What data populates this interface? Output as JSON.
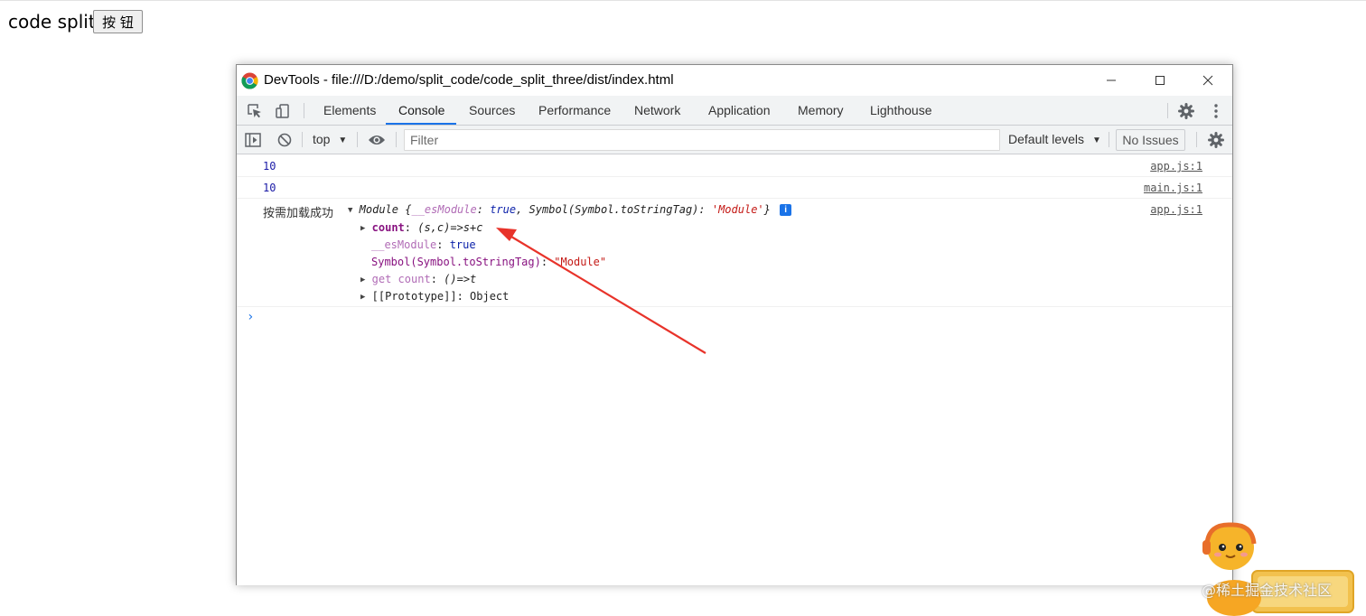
{
  "page": {
    "heading": "code split",
    "button_label": "按 钮"
  },
  "window": {
    "title": "DevTools - file:///D:/demo/split_code/code_split_three/dist/index.html"
  },
  "tabs": [
    {
      "label": "Elements",
      "active": false
    },
    {
      "label": "Console",
      "active": true
    },
    {
      "label": "Sources",
      "active": false
    },
    {
      "label": "Performance",
      "active": false
    },
    {
      "label": "Network",
      "active": false
    },
    {
      "label": "Application",
      "active": false
    },
    {
      "label": "Memory",
      "active": false
    },
    {
      "label": "Lighthouse",
      "active": false
    }
  ],
  "toolbar": {
    "context": "top",
    "filter_placeholder": "Filter",
    "levels": "Default levels",
    "issues": "No Issues"
  },
  "console": {
    "messages": [
      {
        "value": "10",
        "source": "app.js:1"
      },
      {
        "value": "10",
        "source": "main.js:1"
      }
    ],
    "module_log": {
      "label": "按需加载成功",
      "source": "app.js:1",
      "summary": {
        "name": "Module",
        "open": "{",
        "k1": "__esModule",
        "sep": ": ",
        "v1": "true",
        "comma": ", ",
        "k2": "Symbol(Symbol.toStringTag)",
        "v2": "'Module'",
        "close": "}",
        "info": "i"
      },
      "props": {
        "count_key": "count",
        "count_value": "(s,c)=>s+c",
        "es_key": "__esModule",
        "es_value": "true",
        "sym_key": "Symbol(Symbol.toStringTag)",
        "sym_value": "\"Module\"",
        "getter_key": "get count",
        "getter_value": "()=>t",
        "proto_key": "[[Prototype]]",
        "proto_value": "Object"
      }
    }
  },
  "watermark": "@稀土掘金技术社区",
  "colors": {
    "accent": "#1a73e8",
    "annotation_arrow": "#e8332a"
  }
}
